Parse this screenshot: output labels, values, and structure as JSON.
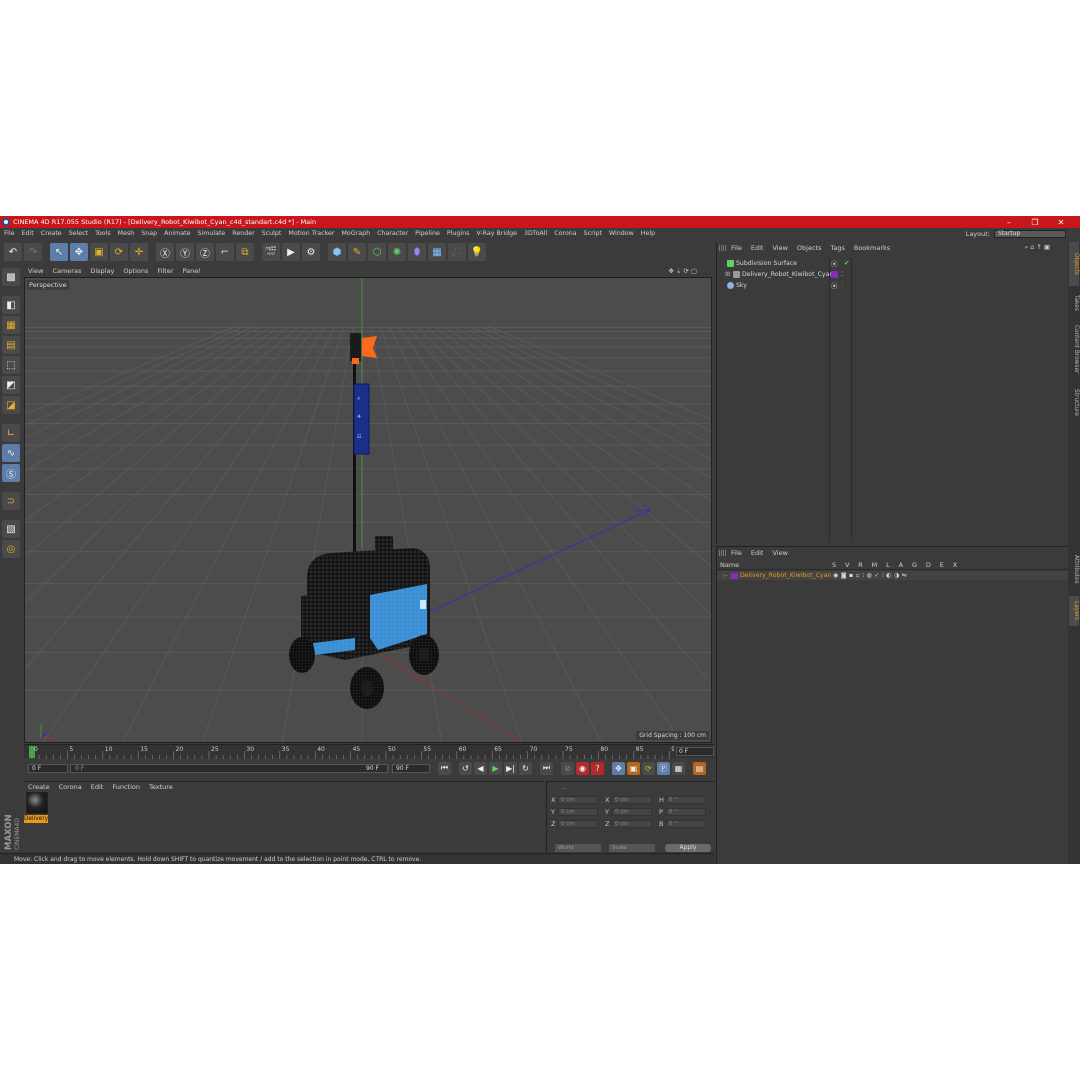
{
  "window": {
    "title": "CINEMA 4D R17.055 Studio (R17) - [Delivery_Robot_Kiwibot_Cyan_c4d_standart.c4d *] - Main",
    "minimize": "–",
    "maximize": "❐",
    "close": "✕"
  },
  "menu": [
    "File",
    "Edit",
    "Create",
    "Select",
    "Tools",
    "Mesh",
    "Snap",
    "Animate",
    "Simulate",
    "Render",
    "Sculpt",
    "Motion Tracker",
    "MoGraph",
    "Character",
    "Pipeline",
    "Plugins",
    "V-Ray Bridge",
    "3DToAll",
    "Corona",
    "Script",
    "Window",
    "Help"
  ],
  "layout": {
    "label": "Layout:",
    "value": "Startup"
  },
  "viewport": {
    "menu": [
      "View",
      "Cameras",
      "Display",
      "Options",
      "Filter",
      "Panel"
    ],
    "label": "Perspective",
    "grid_spacing": "Grid Spacing : 100 cm"
  },
  "timeline": {
    "ticks": [
      "0",
      "5",
      "10",
      "15",
      "20",
      "25",
      "30",
      "35",
      "40",
      "45",
      "50",
      "55",
      "60",
      "65",
      "70",
      "75",
      "80",
      "85",
      "90"
    ],
    "frame_end": "0 F"
  },
  "transport": {
    "start": "0 F",
    "range_start": "0 F",
    "range_end": "90 F",
    "end": "90 F"
  },
  "material_manager": {
    "menu": [
      "Create",
      "Corona",
      "Edit",
      "Function",
      "Texture"
    ],
    "materials": [
      {
        "name": "Delivery"
      }
    ]
  },
  "coordinates": {
    "header": "--",
    "rows": [
      {
        "a": "X",
        "v1": "0 cm",
        "b": "X",
        "v2": "0 cm",
        "c": "H",
        "v3": "0 °"
      },
      {
        "a": "Y",
        "v1": "0 cm",
        "b": "Y",
        "v2": "0 cm",
        "c": "P",
        "v3": "0 °"
      },
      {
        "a": "Z",
        "v1": "0 cm",
        "b": "Z",
        "v2": "0 cm",
        "c": "B",
        "v3": "0 °"
      }
    ],
    "mode": "World",
    "scale": "Scale",
    "apply": "Apply"
  },
  "status": "Move: Click and drag to move elements. Hold down SHIFT to quantize movement / add to the selection in point mode, CTRL to remove.",
  "object_manager": {
    "menu": [
      "File",
      "Edit",
      "View",
      "Objects",
      "Tags",
      "Bookmarks"
    ],
    "objects": [
      {
        "name": "Subdivision Surface",
        "color": "#5fd35f"
      },
      {
        "name": "Delivery_Robot_Kiwibot_Cyan",
        "color": "#9a9a9a"
      },
      {
        "name": "Sky",
        "color": "#8fb3d9"
      }
    ]
  },
  "layer_manager": {
    "menu": [
      "File",
      "Edit",
      "View"
    ],
    "header_name": "Name",
    "header_cols": "S V R M L A G D E X",
    "layers": [
      {
        "name": "Delivery_Robot_Kiwibot_Cyan",
        "color": "#8a2bb5"
      }
    ]
  },
  "side_tabs": [
    "Objects",
    "Takes",
    "Content Browser",
    "Structure",
    "Attributes",
    "Layers"
  ],
  "logo": {
    "line1": "MAXON",
    "line2": "CINEMA4D"
  },
  "colors": {
    "title_bar": "#c8171c",
    "robot_body": "#3b8fd4",
    "flag": "#ff6a1a",
    "accent": "#e69a1c"
  }
}
